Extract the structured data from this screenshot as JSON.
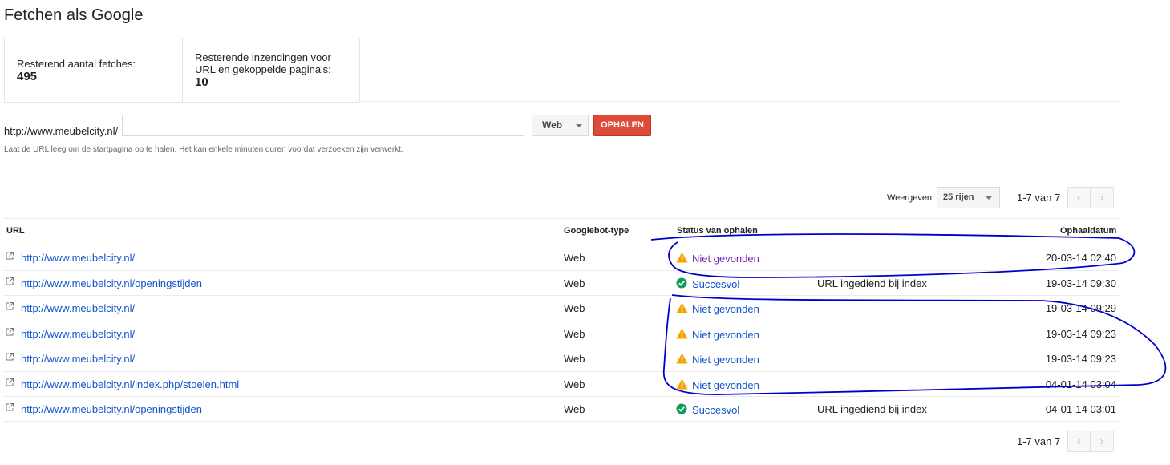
{
  "page_title": "Fetchen als Google",
  "stats": [
    {
      "label": "Resterend aantal fetches:",
      "value": "495"
    },
    {
      "label": "Resterende inzendingen voor URL en gekoppelde pagina's:",
      "value": "10"
    }
  ],
  "fetch": {
    "url_prefix": "http://www.meubelcity.nl/",
    "input_value": "",
    "type_select": "Web",
    "button": "OPHALEN",
    "hint": "Laat de URL leeg om de startpagina op te halen. Het kan enkele minuten duren voordat verzoeken zijn verwerkt."
  },
  "pager": {
    "show_label": "Weergeven",
    "rows_select": "25 rijen",
    "range": "1-7 van 7",
    "prev_icon": "chevron-left-icon",
    "next_icon": "chevron-right-icon"
  },
  "table": {
    "headers": {
      "url": "URL",
      "bot": "Googlebot-type",
      "status": "Status van ophalen",
      "date": "Ophaaldatum"
    },
    "rows": [
      {
        "url": "http://www.meubelcity.nl/",
        "bot": "Web",
        "status": "Niet gevonden",
        "status_icon": "warning-icon",
        "note": "",
        "date": "20-03-14 02:40"
      },
      {
        "url": "http://www.meubelcity.nl/openingstijden",
        "bot": "Web",
        "status": "Succesvol",
        "status_icon": "success-icon",
        "note": "URL ingediend bij index",
        "date": "19-03-14 09:30"
      },
      {
        "url": "http://www.meubelcity.nl/",
        "bot": "Web",
        "status": "Niet gevonden",
        "status_icon": "warning-icon",
        "note": "",
        "date": "19-03-14 09:29"
      },
      {
        "url": "http://www.meubelcity.nl/",
        "bot": "Web",
        "status": "Niet gevonden",
        "status_icon": "warning-icon",
        "note": "",
        "date": "19-03-14 09:23"
      },
      {
        "url": "http://www.meubelcity.nl/",
        "bot": "Web",
        "status": "Niet gevonden",
        "status_icon": "warning-icon",
        "note": "",
        "date": "19-03-14 09:23"
      },
      {
        "url": "http://www.meubelcity.nl/index.php/stoelen.html",
        "bot": "Web",
        "status": "Niet gevonden",
        "status_icon": "warning-icon",
        "note": "",
        "date": "04-01-14 03:04"
      },
      {
        "url": "http://www.meubelcity.nl/openingstijden",
        "bot": "Web",
        "status": "Succesvol",
        "status_icon": "success-icon",
        "note": "URL ingediend bij index",
        "date": "04-01-14 03:01"
      }
    ]
  },
  "colors": {
    "link": "#1155cc",
    "visited": "#7b26b5",
    "button": "#dd4b39",
    "warning": "#f4a300",
    "success": "#0f9d58",
    "annotation": "#0000cc"
  }
}
